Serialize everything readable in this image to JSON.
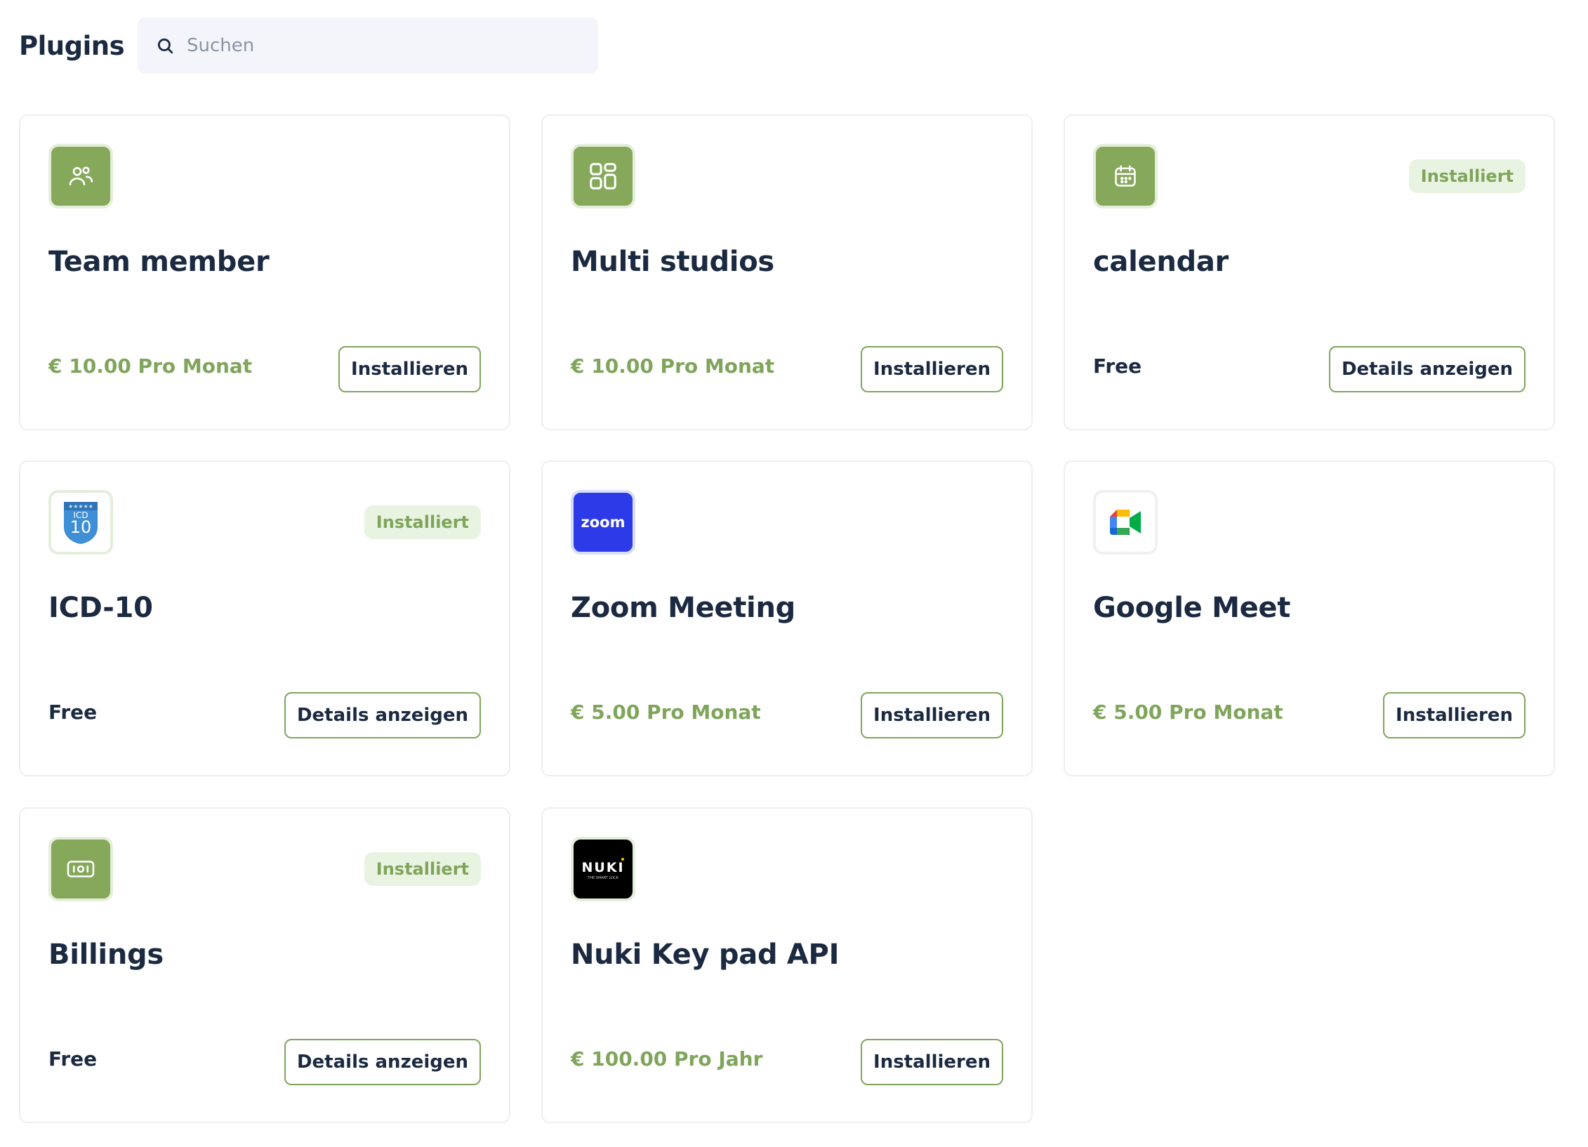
{
  "header": {
    "title": "Plugins",
    "search": {
      "placeholder": "Suchen",
      "value": ""
    }
  },
  "colors": {
    "accent_green": "#86a85a",
    "price_green": "#7fa55b",
    "badge_bg": "#e9f3e1",
    "text_dark": "#1b2a41",
    "zoom_blue": "#2d3ae8"
  },
  "plugins": [
    {
      "icon": "users-icon",
      "title": "Team member",
      "price": "€ 10.00 Pro Monat",
      "action": "Installieren",
      "badge": null
    },
    {
      "icon": "layout-grid-icon",
      "title": "Multi studios",
      "price": "€ 10.00 Pro Monat",
      "action": "Installieren",
      "badge": null
    },
    {
      "icon": "calendar-icon",
      "title": "calendar",
      "price": "Free",
      "action": "Details anzeigen",
      "badge": "Installiert"
    },
    {
      "icon": "icd10-logo-icon",
      "logo_text": "ICD 10",
      "title": "ICD-10",
      "price": "Free",
      "action": "Details anzeigen",
      "badge": "Installiert"
    },
    {
      "icon": "zoom-logo-icon",
      "logo_text": "zoom",
      "title": "Zoom Meeting",
      "price": "€ 5.00 Pro Monat",
      "action": "Installieren",
      "badge": null
    },
    {
      "icon": "google-meet-logo-icon",
      "title": "Google Meet",
      "price": "€ 5.00 Pro Monat",
      "action": "Installieren",
      "badge": null
    },
    {
      "icon": "banknote-icon",
      "title": "Billings",
      "price": "Free",
      "action": "Details anzeigen",
      "badge": "Installiert"
    },
    {
      "icon": "nuki-logo-icon",
      "logo_text": "NUKI THE SMART LOCK",
      "title": "Nuki Key pad API",
      "price": "€ 100.00 Pro Jahr",
      "action": "Installieren",
      "badge": null
    }
  ]
}
